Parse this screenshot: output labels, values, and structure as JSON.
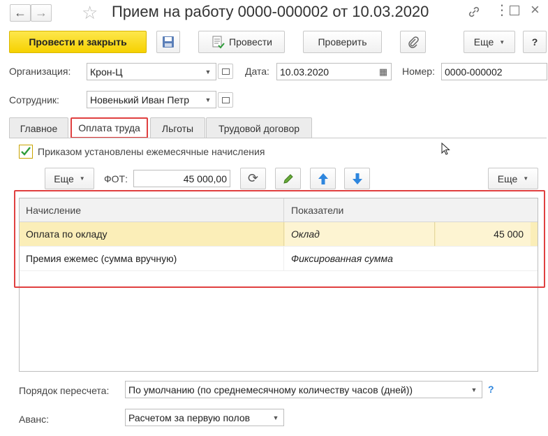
{
  "window": {
    "title": "Прием на работу 0000-000002 от 10.03.2020"
  },
  "toolbar": {
    "post_close_label": "Провести и закрыть",
    "post_label": "Провести",
    "check_label": "Проверить",
    "more_label": "Еще",
    "help_label": "?"
  },
  "header": {
    "org_label": "Организация:",
    "org_value": "Крон-Ц",
    "date_label": "Дата:",
    "date_value": "10.03.2020",
    "number_label": "Номер:",
    "number_value": "0000-000002",
    "employee_label": "Сотрудник:",
    "employee_value": "Новенький Иван Петр"
  },
  "tabs": [
    {
      "label": "Главное",
      "active": false
    },
    {
      "label": "Оплата труда",
      "active": true
    },
    {
      "label": "Льготы",
      "active": false
    },
    {
      "label": "Трудовой договор",
      "active": false
    }
  ],
  "pay": {
    "monthly_checkbox_label": "Приказом установлены ежемесячные начисления",
    "monthly_checked": true,
    "more_label": "Еще",
    "fot_label": "ФОТ:",
    "fot_value": "45 000,00",
    "more_right_label": "Еще"
  },
  "grid": {
    "columns": [
      "Начисление",
      "Показатели"
    ],
    "rows": [
      {
        "accrual": "Оплата по окладу",
        "indicator": "Оклад",
        "value": "45 000",
        "selected": true
      },
      {
        "accrual": "Премия ежемес (сумма вручную)",
        "indicator": "Фиксированная сумма",
        "value": "",
        "selected": false
      }
    ]
  },
  "footer": {
    "recalc_label": "Порядок пересчета:",
    "recalc_value": "По умолчанию (по среднемесячному количеству часов (дней))",
    "recalc_help": "?",
    "advance_label": "Аванс:",
    "advance_value": "Расчетом за первую полов"
  },
  "colors": {
    "primary_button": "#f6d100",
    "highlight_border": "#e04040",
    "selected_row": "#fbeeb8",
    "arrow_blue": "#2e86de",
    "checkbox_green": "#2e9c3a"
  }
}
